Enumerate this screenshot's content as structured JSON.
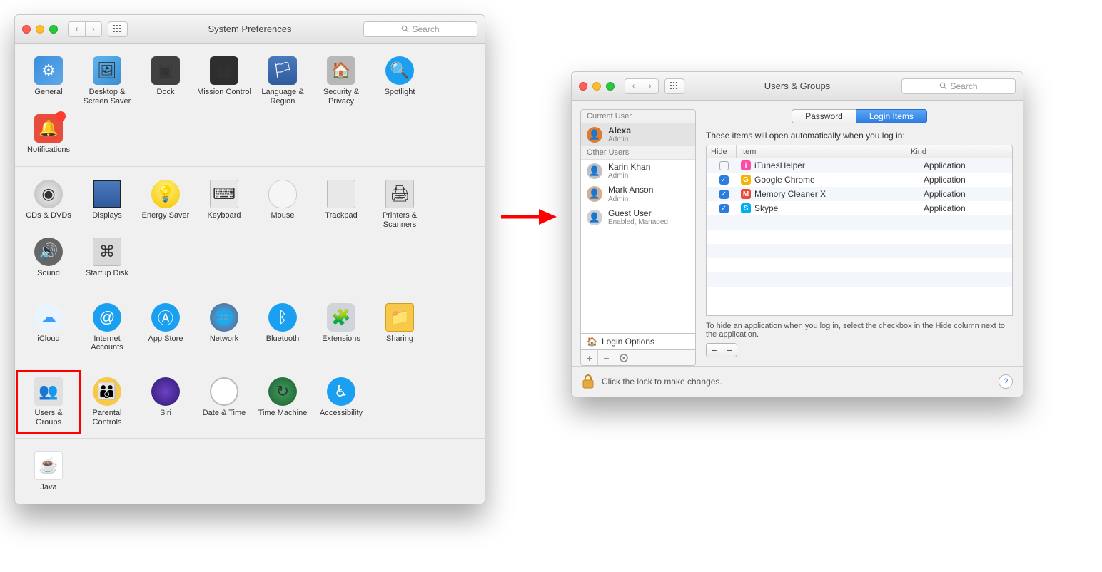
{
  "win1": {
    "title": "System Preferences",
    "search_placeholder": "Search",
    "sections": [
      [
        {
          "label": "General",
          "icon": "bg-general"
        },
        {
          "label": "Desktop & Screen Saver",
          "icon": "bg-desktop"
        },
        {
          "label": "Dock",
          "icon": "bg-dock"
        },
        {
          "label": "Mission Control",
          "icon": "bg-mission"
        },
        {
          "label": "Language & Region",
          "icon": "bg-flag"
        },
        {
          "label": "Security & Privacy",
          "icon": "bg-security"
        },
        {
          "label": "Spotlight",
          "icon": "bg-spotlight"
        },
        {
          "label": "Notifications",
          "icon": "bg-notif",
          "badge": true
        }
      ],
      [
        {
          "label": "CDs & DVDs",
          "icon": "bg-disc"
        },
        {
          "label": "Displays",
          "icon": "bg-display"
        },
        {
          "label": "Energy Saver",
          "icon": "bg-energy"
        },
        {
          "label": "Keyboard",
          "icon": "bg-keyboard"
        },
        {
          "label": "Mouse",
          "icon": "bg-mouse"
        },
        {
          "label": "Trackpad",
          "icon": "bg-trackpad"
        },
        {
          "label": "Printers & Scanners",
          "icon": "bg-printer"
        },
        {
          "label": "Sound",
          "icon": "bg-sound"
        },
        {
          "label": "Startup Disk",
          "icon": "bg-startup"
        }
      ],
      [
        {
          "label": "iCloud",
          "icon": "bg-icloud"
        },
        {
          "label": "Internet Accounts",
          "icon": "bg-internet"
        },
        {
          "label": "App Store",
          "icon": "bg-appstore"
        },
        {
          "label": "Network",
          "icon": "bg-network"
        },
        {
          "label": "Bluetooth",
          "icon": "bg-bluetooth"
        },
        {
          "label": "Extensions",
          "icon": "bg-extensions"
        },
        {
          "label": "Sharing",
          "icon": "bg-sharing"
        }
      ],
      [
        {
          "label": "Users & Groups",
          "icon": "bg-users",
          "highlight": true
        },
        {
          "label": "Parental Controls",
          "icon": "bg-parental"
        },
        {
          "label": "Siri",
          "icon": "bg-siri"
        },
        {
          "label": "Date & Time",
          "icon": "bg-datetime"
        },
        {
          "label": "Time Machine",
          "icon": "bg-timemachine"
        },
        {
          "label": "Accessibility",
          "icon": "bg-accessibility"
        }
      ],
      [
        {
          "label": "Java",
          "icon": "bg-java"
        }
      ]
    ]
  },
  "win2": {
    "title": "Users & Groups",
    "search_placeholder": "Search",
    "sidebar": {
      "current_header": "Current User",
      "other_header": "Other Users",
      "current_user": {
        "name": "Alexa",
        "role": "Admin",
        "avatar_color": "#e07a2e"
      },
      "other_users": [
        {
          "name": "Karin Khan",
          "role": "Admin",
          "avatar_color": "#c0c0c0"
        },
        {
          "name": "Mark Anson",
          "role": "Admin",
          "avatar_color": "#d4b090"
        },
        {
          "name": "Guest User",
          "role": "Enabled, Managed",
          "avatar_color": "#d0d0d0"
        }
      ],
      "login_options": "Login Options"
    },
    "tabs": {
      "password": "Password",
      "login_items": "Login Items"
    },
    "info": "These items will open automatically when you log in:",
    "columns": {
      "hide": "Hide",
      "item": "Item",
      "kind": "Kind"
    },
    "items": [
      {
        "hide": false,
        "name": "iTunesHelper",
        "kind": "Application",
        "color": "#ff4aa6"
      },
      {
        "hide": true,
        "name": "Google Chrome",
        "kind": "Application",
        "color": "#f4b400"
      },
      {
        "hide": true,
        "name": "Memory Cleaner X",
        "kind": "Application",
        "color": "#e74c3c"
      },
      {
        "hide": true,
        "name": "Skype",
        "kind": "Application",
        "color": "#00aff0"
      }
    ],
    "hint": "To hide an application when you log in, select the checkbox in the Hide column next to the application.",
    "lock_text": "Click the lock to make changes."
  }
}
